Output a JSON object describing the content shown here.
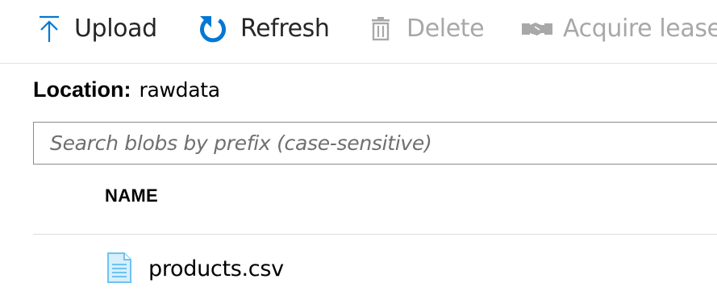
{
  "toolbar": {
    "upload": {
      "label": "Upload",
      "icon": "upload-arrow-icon",
      "enabled": true
    },
    "refresh": {
      "label": "Refresh",
      "icon": "refresh-icon",
      "enabled": true
    },
    "delete": {
      "label": "Delete",
      "icon": "trash-icon",
      "enabled": false
    },
    "acquire_lease": {
      "label": "Acquire lease",
      "icon": "lease-icon",
      "enabled": false
    }
  },
  "location": {
    "label": "Location:",
    "value": "rawdata"
  },
  "search": {
    "placeholder": "Search blobs by prefix (case-sensitive)",
    "value": ""
  },
  "grid": {
    "columns": [
      "NAME"
    ],
    "rows": [
      {
        "name": "products.csv",
        "icon": "file-document-icon"
      }
    ]
  },
  "colors": {
    "accent": "#0078d4",
    "text": "#262626",
    "disabled": "#a8a8a8",
    "divider": "#dcdcdc",
    "file_icon": "#6ec3f0"
  }
}
